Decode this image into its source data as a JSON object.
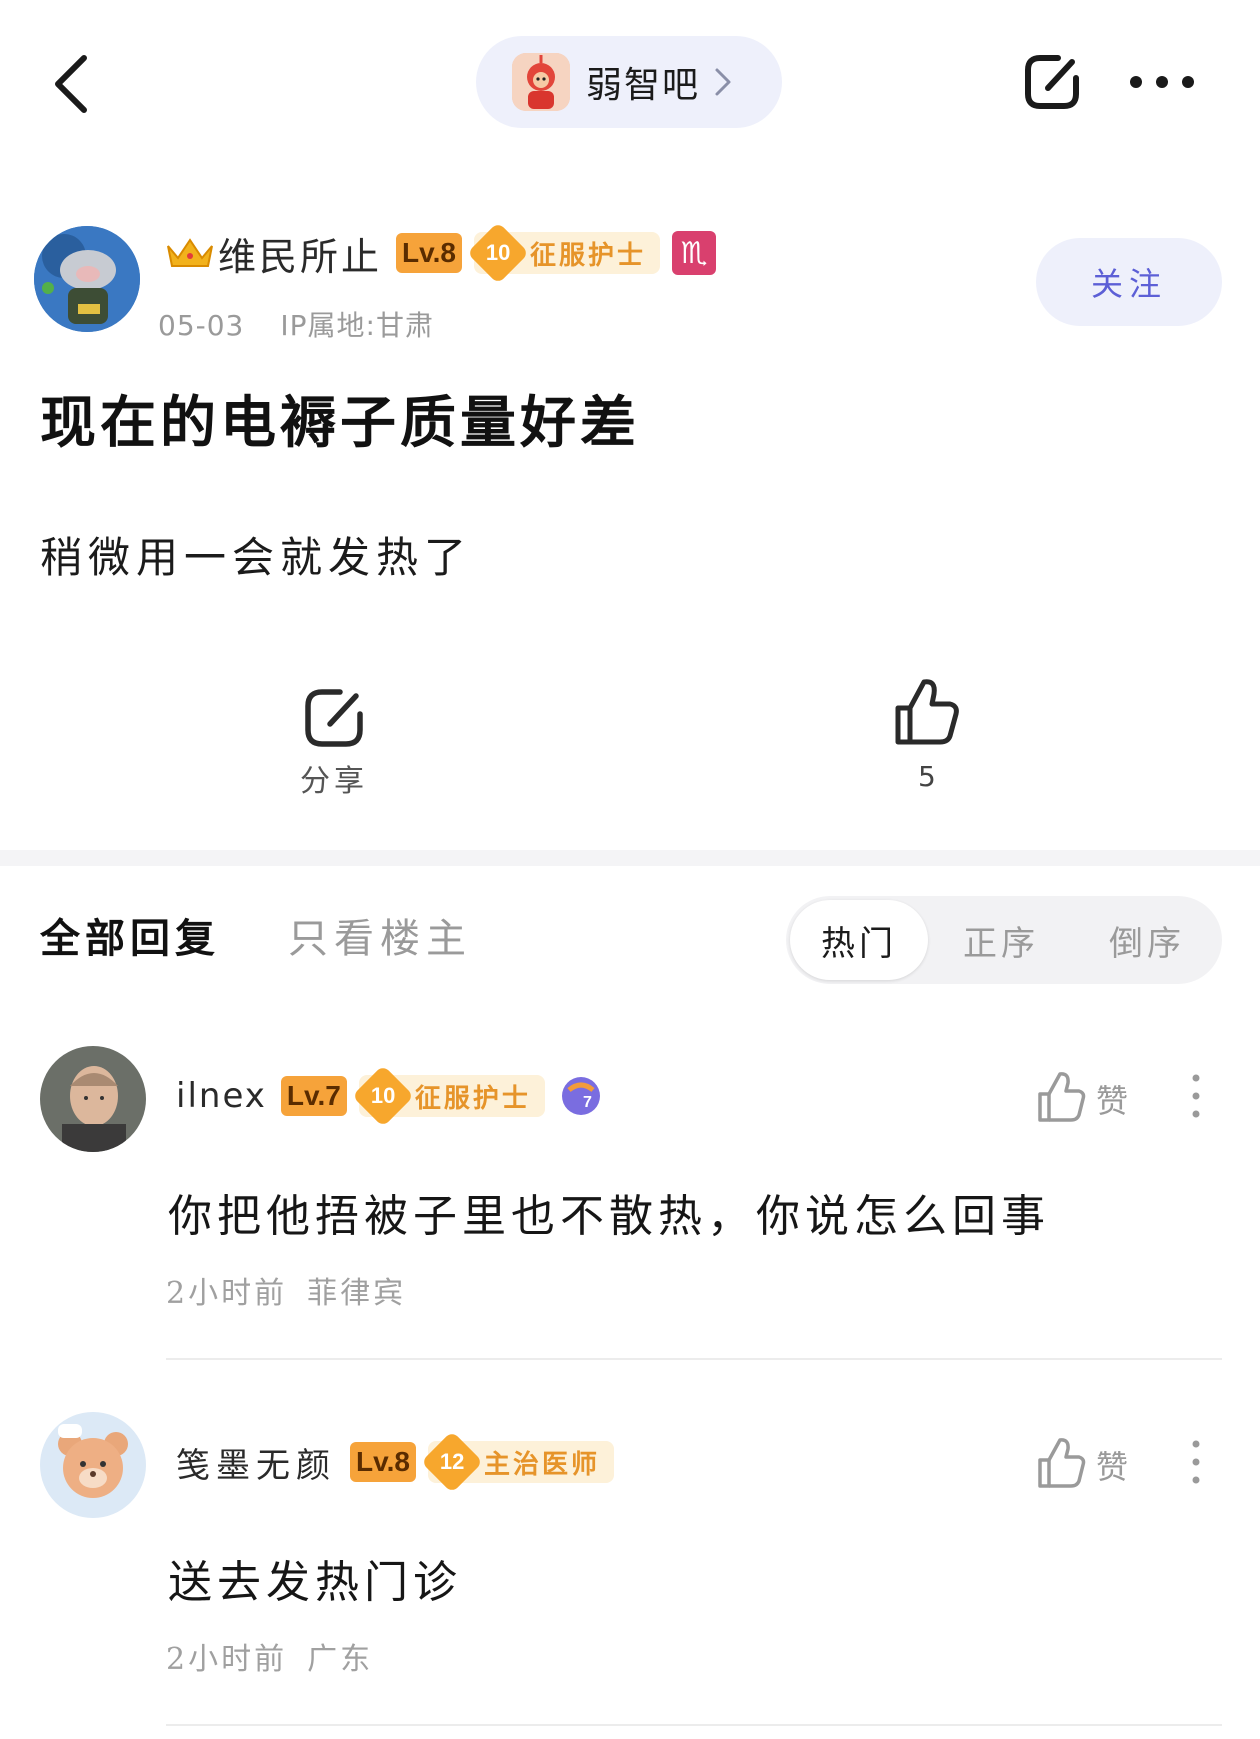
{
  "topbar": {
    "forum_name": "弱智吧",
    "icons": [
      "back-arrow",
      "forum-avatar",
      "chevron-right",
      "share",
      "more"
    ]
  },
  "post": {
    "author": {
      "name": "维民所止",
      "level": "Lv.8",
      "rank_number": "10",
      "rank_title": "征服护士",
      "zodiac": "♏"
    },
    "date": "05-03",
    "ip": "IP属地:甘肃",
    "follow_label": "关注",
    "title": "现在的电褥子质量好差",
    "body": "稍微用一会就发热了",
    "share_label": "分享",
    "like_count": "5"
  },
  "tabs": {
    "all": "全部回复",
    "op_only": "只看楼主",
    "sort": [
      "热门",
      "正序",
      "倒序"
    ],
    "sort_selected": "热门"
  },
  "comments": [
    {
      "name": "ilnex",
      "level": "Lv.7",
      "rank_number": "10",
      "rank_title": "征服护士",
      "text": "你把他捂被子里也不散热，你说怎么回事",
      "time": "2小时前",
      "location": "菲律宾",
      "like_label": "赞"
    },
    {
      "name": "笺墨无颜",
      "level": "Lv.8",
      "rank_number": "12",
      "rank_title": "主治医师",
      "text": "送去发热门诊",
      "time": "2小时前",
      "location": "广东",
      "like_label": "赞"
    }
  ],
  "colors": {
    "accent": "#5c5fd6",
    "pill_bg": "#eef0fb",
    "level_orange": "#f6a33a",
    "rank_text": "#e6942a",
    "meta_gray": "#9a9a9a"
  }
}
